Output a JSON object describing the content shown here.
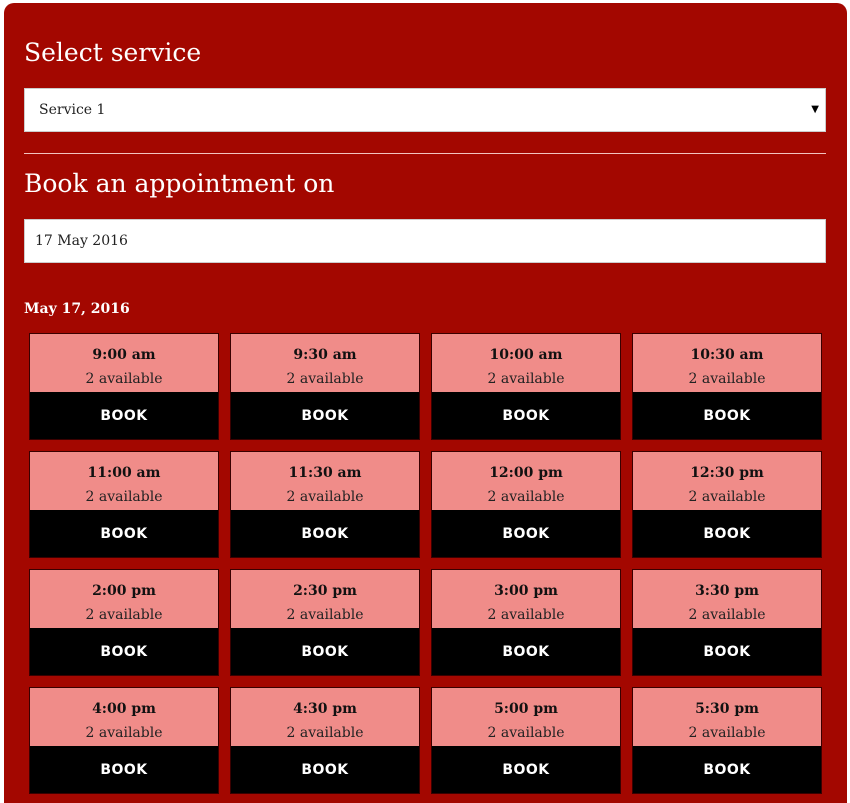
{
  "service_section": {
    "heading": "Select service",
    "selected_service": "Service 1"
  },
  "date_section": {
    "heading": "Book an appointment on",
    "date_value": "17 May 2016"
  },
  "slots_section": {
    "date_label": "May 17, 2016",
    "book_label": "BOOK",
    "slots": [
      {
        "time": "9:00 am",
        "availability": "2 available"
      },
      {
        "time": "9:30 am",
        "availability": "2 available"
      },
      {
        "time": "10:00 am",
        "availability": "2 available"
      },
      {
        "time": "10:30 am",
        "availability": "2 available"
      },
      {
        "time": "11:00 am",
        "availability": "2 available"
      },
      {
        "time": "11:30 am",
        "availability": "2 available"
      },
      {
        "time": "12:00 pm",
        "availability": "2 available"
      },
      {
        "time": "12:30 pm",
        "availability": "2 available"
      },
      {
        "time": "2:00 pm",
        "availability": "2 available"
      },
      {
        "time": "2:30 pm",
        "availability": "2 available"
      },
      {
        "time": "3:00 pm",
        "availability": "2 available"
      },
      {
        "time": "3:30 pm",
        "availability": "2 available"
      },
      {
        "time": "4:00 pm",
        "availability": "2 available"
      },
      {
        "time": "4:30 pm",
        "availability": "2 available"
      },
      {
        "time": "5:00 pm",
        "availability": "2 available"
      },
      {
        "time": "5:30 pm",
        "availability": "2 available"
      }
    ]
  },
  "icons": {
    "select_caret": "caret-down-icon"
  },
  "colors": {
    "panel_background": "#a30700",
    "slot_background": "#f08c89",
    "button_background": "#000000"
  }
}
